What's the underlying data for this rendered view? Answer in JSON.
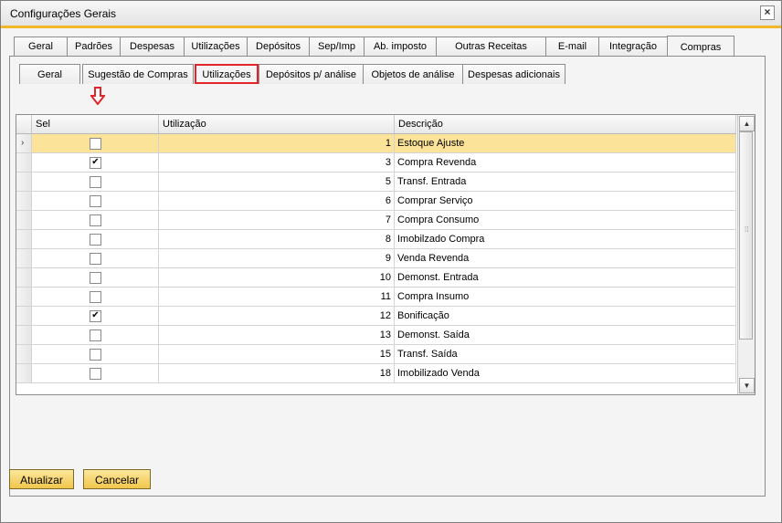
{
  "window": {
    "title": "Configurações Gerais"
  },
  "tabs": [
    {
      "label": "Geral"
    },
    {
      "label": "Padrões"
    },
    {
      "label": "Despesas"
    },
    {
      "label": "Utilizações"
    },
    {
      "label": "Depósitos"
    },
    {
      "label": "Sep/Imp"
    },
    {
      "label": "Ab. imposto"
    },
    {
      "label": "Outras Receitas"
    },
    {
      "label": "E-mail"
    },
    {
      "label": "Integração"
    },
    {
      "label": "Compras"
    }
  ],
  "subtabs": [
    {
      "label": "Geral"
    },
    {
      "label": "Sugestão de Compras"
    },
    {
      "label": "Utilizações"
    },
    {
      "label": "Depósitos p/ análise"
    },
    {
      "label": "Objetos de análise"
    },
    {
      "label": "Despesas adicionais"
    }
  ],
  "grid": {
    "columns": {
      "sel": "Sel",
      "utilizacao": "Utilização",
      "descricao": "Descrição"
    },
    "rows": [
      {
        "checked": false,
        "util": "1",
        "desc": "Estoque Ajuste"
      },
      {
        "checked": true,
        "util": "3",
        "desc": "Compra Revenda"
      },
      {
        "checked": false,
        "util": "5",
        "desc": "Transf. Entrada"
      },
      {
        "checked": false,
        "util": "6",
        "desc": "Comprar Serviço"
      },
      {
        "checked": false,
        "util": "7",
        "desc": "Compra Consumo"
      },
      {
        "checked": false,
        "util": "8",
        "desc": "Imobilzado Compra"
      },
      {
        "checked": false,
        "util": "9",
        "desc": "Venda Revenda"
      },
      {
        "checked": false,
        "util": "10",
        "desc": "Demonst. Entrada"
      },
      {
        "checked": false,
        "util": "11",
        "desc": "Compra Insumo"
      },
      {
        "checked": true,
        "util": "12",
        "desc": "Bonificação"
      },
      {
        "checked": false,
        "util": "13",
        "desc": "Demonst. Saída"
      },
      {
        "checked": false,
        "util": "15",
        "desc": "Transf. Saída"
      },
      {
        "checked": false,
        "util": "18",
        "desc": "Imobilizado Venda"
      }
    ]
  },
  "buttons": {
    "update": "Atualizar",
    "cancel": "Cancelar"
  },
  "colors": {
    "highlight": "#e0262b",
    "selected_row": "#fbe39a",
    "button": "#f1c64b",
    "title_accent": "#f3b82a"
  }
}
